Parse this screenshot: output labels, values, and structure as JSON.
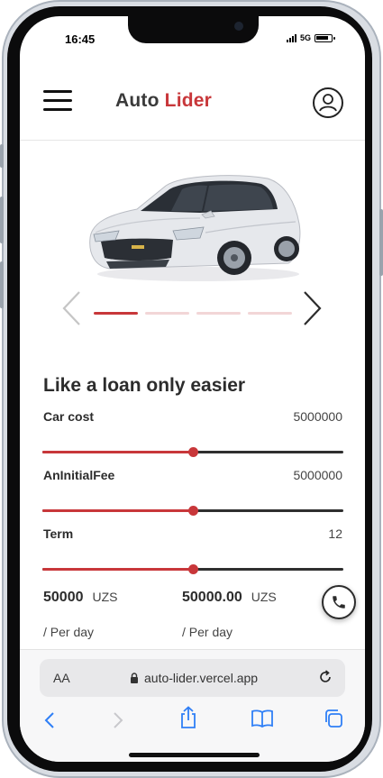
{
  "status_bar": {
    "time": "16:45",
    "network": "5G"
  },
  "header": {
    "logo_part1": "Auto",
    "logo_part2": "Lider"
  },
  "carousel": {
    "slides": 4,
    "active_index": 0
  },
  "calculator": {
    "title": "Like a loan only easier",
    "rows": [
      {
        "label": "Car cost",
        "value": "5000000",
        "level": 0.5
      },
      {
        "label": "AnInitialFee",
        "value": "5000000",
        "level": 0.5
      },
      {
        "label": "Term",
        "value": "12",
        "level": 0.5
      }
    ],
    "results": [
      {
        "amount": "50000",
        "currency": "UZS",
        "period": "/ Per day"
      },
      {
        "amount": "50000.00",
        "currency": "UZS",
        "period": "/ Per day"
      }
    ]
  },
  "browser": {
    "aa_label": "AA",
    "url": "auto-lider.vercel.app"
  },
  "colors": {
    "accent": "#c8373a",
    "dark": "#2c2c2c",
    "accent_light": "#f2d6d7"
  },
  "icons": [
    "menu-icon",
    "user-icon",
    "chevron-left-icon",
    "chevron-right-icon",
    "phone-icon",
    "lock-icon",
    "reload-icon",
    "back-icon",
    "forward-icon",
    "share-icon",
    "bookmarks-icon",
    "tabs-icon"
  ]
}
